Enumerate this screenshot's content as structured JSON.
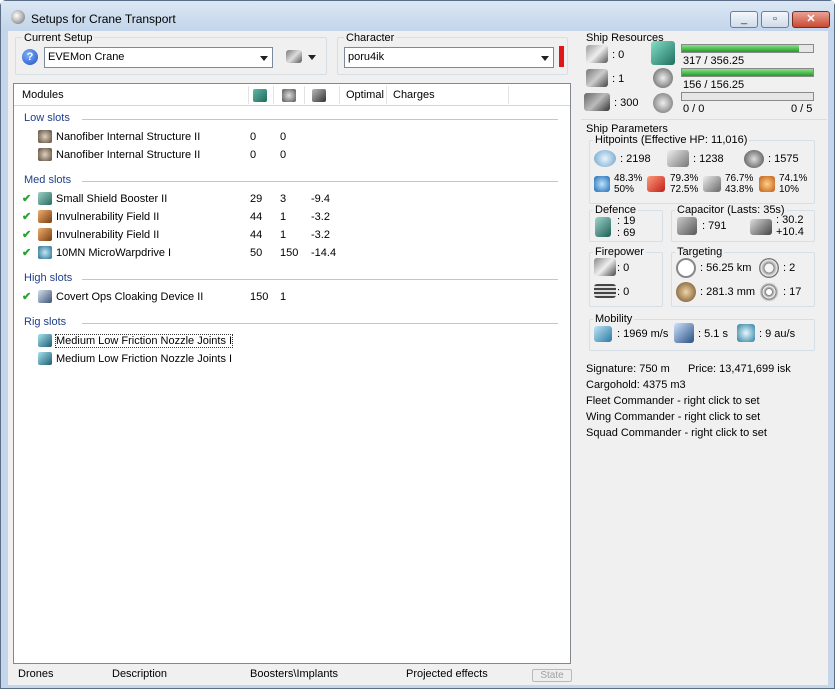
{
  "window": {
    "title": "Setups for Crane Transport"
  },
  "setup": {
    "label": "Current Setup",
    "value": "EVEMon Crane"
  },
  "character": {
    "label": "Character",
    "value": "poru4ik",
    "status_color": "#e0161a"
  },
  "modules_panel": {
    "columns": {
      "modules": "Modules",
      "optimal": "Optimal",
      "charges": "Charges"
    },
    "sections": [
      {
        "title": "Low slots",
        "items": [
          {
            "name": "Nanofiber Internal Structure II",
            "c1": "0",
            "c2": "0",
            "c3": "",
            "checked": false,
            "icon": "nanofiber-icon"
          },
          {
            "name": "Nanofiber Internal Structure II",
            "c1": "0",
            "c2": "0",
            "c3": "",
            "checked": false,
            "icon": "nanofiber-icon"
          }
        ]
      },
      {
        "title": "Med slots",
        "items": [
          {
            "name": "Small Shield Booster II",
            "c1": "29",
            "c2": "3",
            "c3": "-9.4",
            "checked": true,
            "icon": "shield-booster-icon"
          },
          {
            "name": "Invulnerability Field II",
            "c1": "44",
            "c2": "1",
            "c3": "-3.2",
            "checked": true,
            "icon": "invulnerability-field-icon"
          },
          {
            "name": "Invulnerability Field II",
            "c1": "44",
            "c2": "1",
            "c3": "-3.2",
            "checked": true,
            "icon": "invulnerability-field-icon"
          },
          {
            "name": "10MN MicroWarpdrive I",
            "c1": "50",
            "c2": "150",
            "c3": "-14.4",
            "checked": true,
            "icon": "microwarpdrive-icon"
          }
        ]
      },
      {
        "title": "High slots",
        "items": [
          {
            "name": "Covert Ops Cloaking Device II",
            "c1": "150",
            "c2": "1",
            "c3": "",
            "checked": true,
            "icon": "cloaking-device-icon"
          }
        ]
      },
      {
        "title": "Rig slots",
        "items": [
          {
            "name": "Medium Low Friction Nozzle Joints I",
            "c1": "",
            "c2": "",
            "c3": "",
            "checked": false,
            "icon": "rig-icon"
          },
          {
            "name": "Medium Low Friction Nozzle Joints I",
            "c1": "",
            "c2": "",
            "c3": "",
            "checked": false,
            "icon": "rig-icon"
          }
        ]
      }
    ]
  },
  "bottom_tabs": {
    "drones": "Drones",
    "description": "Description",
    "boosters": "Boosters\\Implants",
    "projected": "Projected effects",
    "state": "State"
  },
  "resources": {
    "title": "Ship Resources",
    "turrets": ": 0",
    "launchers": ": 1",
    "calibration": ": 300",
    "cpu_text": "317 / 356.25",
    "cpu_fraction": 0.89,
    "pg_text": "156 / 156.25",
    "pg_fraction": 0.998,
    "drone_text": "0 / 0",
    "drone_fraction": 0,
    "drone_count": "0 / 5"
  },
  "params": {
    "title": "Ship Parameters",
    "hitpoints_title": "Hitpoints (Effective HP: 11,016)",
    "shield_hp": ": 2198",
    "armor_hp": ": 1238",
    "hull_hp": ": 1575",
    "res_em": [
      "48.3%",
      "50%"
    ],
    "res_thermal": [
      "79.3%",
      "72.5%"
    ],
    "res_kinetic": [
      "76.7%",
      "43.8%"
    ],
    "res_explosive": [
      "74.1%",
      "10%"
    ],
    "defence_title": "Defence",
    "defence_1": ": 19",
    "defence_2": ": 69",
    "capacitor_title": "Capacitor (Lasts: 35s)",
    "cap_amount": ": 791",
    "cap_recharge_1": ": 30.2",
    "cap_recharge_2": "+10.4",
    "firepower_title": "Firepower",
    "fp_1": ": 0",
    "fp_2": ": 0",
    "targeting_title": "Targeting",
    "tgt_range": ": 56.25 km",
    "tgt_targets": ": 2",
    "tgt_scan": ": 281.3 mm",
    "tgt_sensor": ": 17",
    "mobility_title": "Mobility",
    "speed": ": 1969 m/s",
    "align": ": 5.1 s",
    "warp": ": 9 au/s"
  },
  "info": {
    "signature": "Signature: 750 m",
    "price": "Price: 13,471,699 isk",
    "cargo": "Cargohold: 4375 m3",
    "fleet": "Fleet Commander - right click to set",
    "wing": "Wing Commander - right click to set",
    "squad": "Squad Commander - right click to set"
  },
  "colors": {
    "section_title": "#1e3f8a",
    "check": "#23a52f",
    "bar_fill": "#1d9e25"
  }
}
